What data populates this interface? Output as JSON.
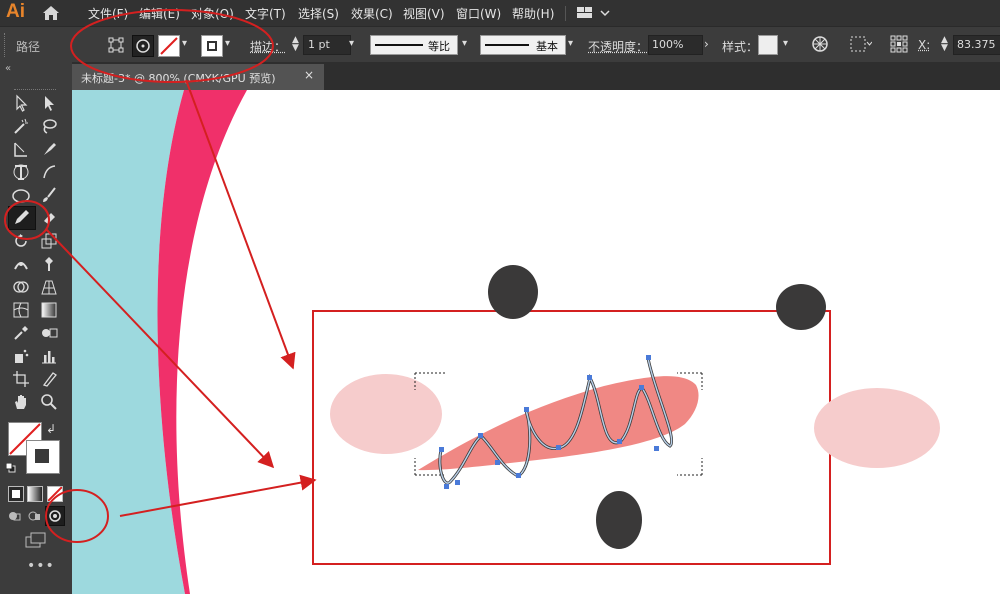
{
  "app": {
    "logo": "Ai"
  },
  "menu": {
    "items": [
      "文件(F)",
      "编辑(E)",
      "对象(O)",
      "文字(T)",
      "选择(S)",
      "效果(C)",
      "视图(V)",
      "窗口(W)",
      "帮助(H)"
    ]
  },
  "control_bar": {
    "object_label": "路径",
    "stroke_label": "描边：",
    "stroke_weight": "1 pt",
    "profile_label": "等比",
    "brush_label": "基本",
    "opacity_label": "不透明度：",
    "opacity_value": "100%",
    "style_label": "样式：",
    "x_label": "X:",
    "x_value": "83.375"
  },
  "document": {
    "tab_title": "未标题-3* @ 800% (CMYK/GPU 预览)"
  },
  "colors": {
    "accent_red": "#d42020",
    "teal": "#9dd9de",
    "magenta": "#f0306a",
    "dark_dot": "#3a3939",
    "pink": "#f6cccc",
    "salmon": "#f08884",
    "anchor_blue": "#4a7ad8"
  },
  "icons": [
    "home-icon",
    "workspace-icon",
    "selection-tool-icon",
    "direct-selection-tool-icon",
    "magic-wand-icon",
    "lasso-icon",
    "pen-tool-icon",
    "curvature-tool-icon",
    "type-tool-icon",
    "line-tool-icon",
    "ellipse-tool-icon",
    "paintbrush-tool-icon",
    "pencil-tool-icon",
    "eraser-tool-icon",
    "rotate-tool-icon",
    "scale-tool-icon",
    "width-tool-icon",
    "puppet-warp-icon",
    "shape-builder-icon",
    "perspective-grid-icon",
    "mesh-tool-icon",
    "gradient-tool-icon",
    "eyedropper-tool-icon",
    "blend-tool-icon",
    "symbol-sprayer-icon",
    "column-graph-icon",
    "artboard-tool-icon",
    "slice-tool-icon",
    "hand-tool-icon",
    "zoom-tool-icon"
  ]
}
